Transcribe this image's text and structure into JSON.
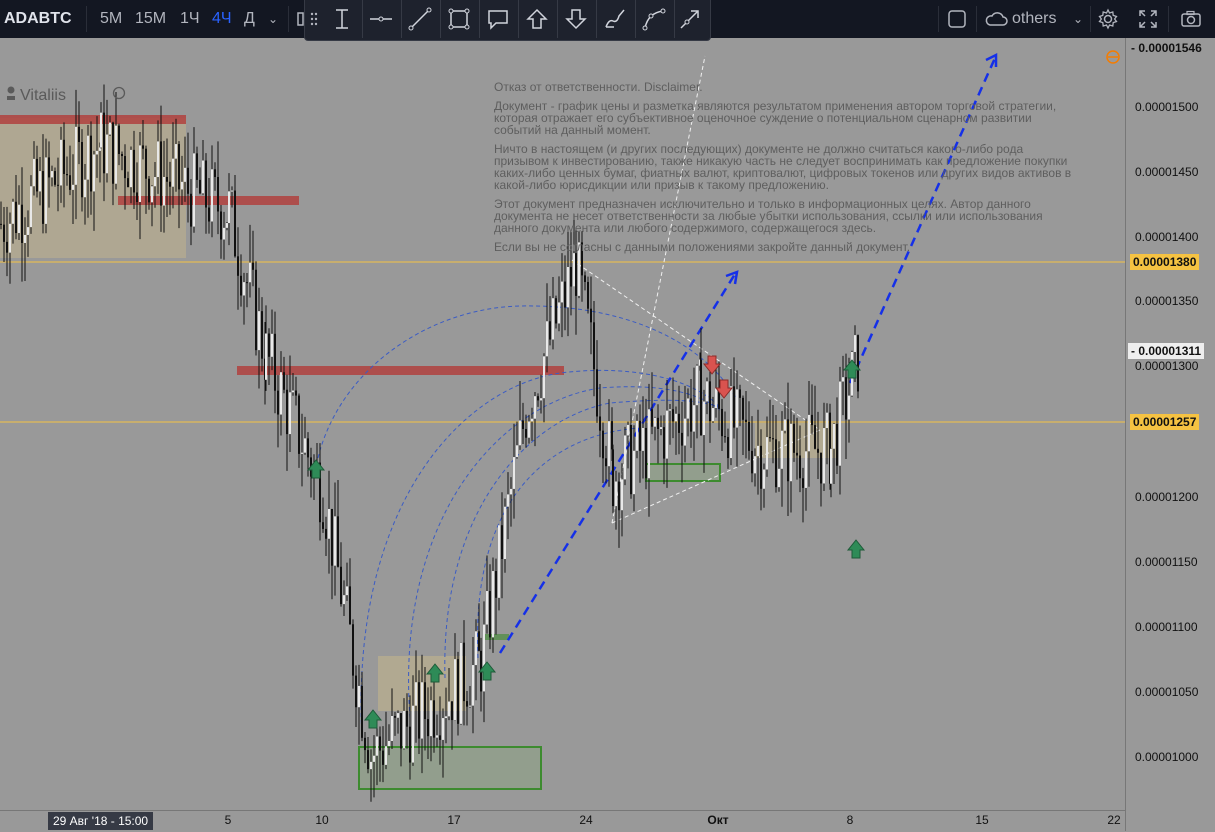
{
  "toolbar": {
    "symbol": "ADABTC",
    "intervals": [
      "5М",
      "15М",
      "1Ч",
      "4Ч",
      "Д"
    ],
    "active_interval": "4Ч",
    "layout_name": "others",
    "colors": {
      "bg": "#131722",
      "active": "#2962ff",
      "text": "#b2b5be"
    }
  },
  "drawing_tools": [
    "cursor-icon",
    "text-cursor-icon",
    "horizontal-line-icon",
    "trend-line-icon",
    "rectangle-icon",
    "callout-icon",
    "arrow-up-icon",
    "arrow-down-icon",
    "brush-icon",
    "curve-icon",
    "arrow-line-icon"
  ],
  "watermark": {
    "author": "Vitaliis"
  },
  "disclaimer": {
    "p1": "Отказ от ответственности. Disclaimer.",
    "p2": "Документ - график цены и разметка являются результатом применения автором торговой стратегии, которая отражает его субъективное оценочное суждение о потенциальном сценарном развитии событий на данный момент.",
    "p3": "Ничто в настоящем (и других последующих) документе не должно считаться какого-либо рода призывом к инвестированию, также никакую часть не следует воспринимать как предложение покупки каких-либо ценных бумаг, фиатных валют, криптовалют, цифровых токенов или других видов активов в какой-либо юрисдикции или призыв к такому предложению.",
    "p4": "Этот документ предназначен исключительно и только в информационных целях. Автор данного документа не несет ответственности за любые убытки использования, ссылки или использования данного документа или любого содержимого, содержащегося здесь.",
    "p5": "Если вы не согласны с данными положениями закройте данный документ."
  },
  "price_axis": {
    "ticks": [
      "0.00001500",
      "0.00001450",
      "0.00001400",
      "0.00001350",
      "0.00001300",
      "0.00001250",
      "0.00001200",
      "0.00001150",
      "0.00001100",
      "0.00001050",
      "0.00001000"
    ],
    "tags": {
      "top": "0.00001546",
      "level_high": "0.00001380",
      "last": "0.00001311",
      "level_low": "0.00001257"
    },
    "level_color": "#f5c242"
  },
  "time_axis": {
    "labels": [
      "5",
      "10",
      "17",
      "24",
      "Окт",
      "8",
      "15",
      "22"
    ],
    "cursor_label": "29 Авг '18 - 15:00"
  },
  "chart_data": {
    "type": "candlestick",
    "title": "ADABTC",
    "interval": "4Ч",
    "ylim": [
      9.7e-06,
      1.55e-05
    ],
    "key_levels": [
      1.38e-05,
      1.257e-05
    ],
    "last_price": 1.311e-05,
    "candles_approx": [
      {
        "date": "Aug 29",
        "close": 1.41e-05
      },
      {
        "date": "Sep 2",
        "close": 1.47e-05
      },
      {
        "date": "Sep 5",
        "close": 1.42e-05
      },
      {
        "date": "Sep 7",
        "close": 1.31e-05
      },
      {
        "date": "Sep 10",
        "close": 1.21e-05
      },
      {
        "date": "Sep 13",
        "close": 1.01e-05
      },
      {
        "date": "Sep 17",
        "close": 1.06e-05
      },
      {
        "date": "Sep 19",
        "close": 1.08e-05
      },
      {
        "date": "Sep 21",
        "close": 1.27e-05
      },
      {
        "date": "Sep 24",
        "close": 1.38e-05
      },
      {
        "date": "Sep 27",
        "close": 1.22e-05
      },
      {
        "date": "Oct 1",
        "close": 1.28e-05
      },
      {
        "date": "Oct 4",
        "close": 1.24e-05
      },
      {
        "date": "Oct 7",
        "close": 1.24e-05
      },
      {
        "date": "Oct 8",
        "close": 1.31e-05
      }
    ]
  }
}
